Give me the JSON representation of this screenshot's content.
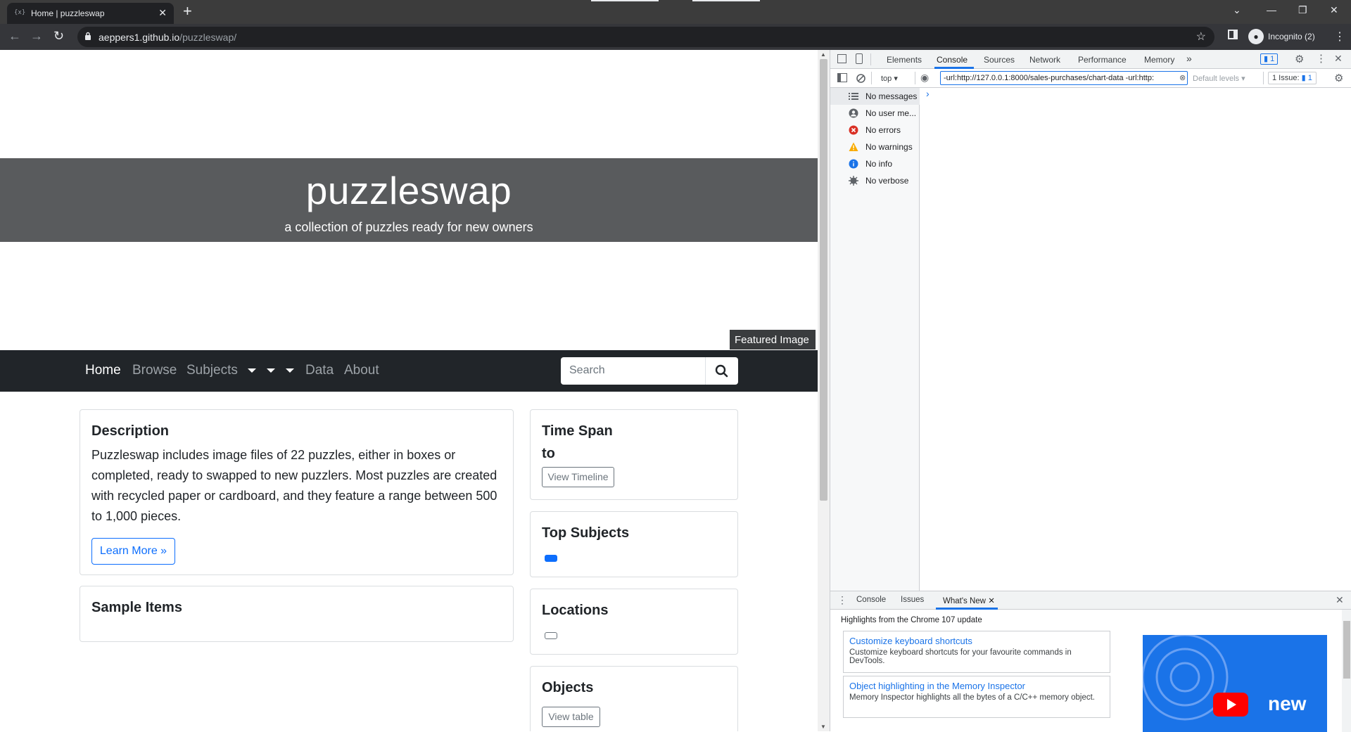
{
  "browser": {
    "tab_title": "Home | puzzleswap",
    "tab_favicon": "{x}",
    "url_host": "aeppers1.github.io",
    "url_path": "/puzzleswap/",
    "profile_label": "Incognito (2)"
  },
  "site": {
    "title": "puzzleswap",
    "subtitle": "a collection of puzzles ready for new owners",
    "featured_label": "Featured Image",
    "nav": {
      "home": "Home",
      "browse": "Browse",
      "subjects": "Subjects",
      "data": "Data",
      "about": "About"
    },
    "search_placeholder": "Search",
    "description": {
      "heading": "Description",
      "body": "Puzzleswap includes image files of 22 puzzles, either in boxes or completed, ready to swapped to new puzzlers. Most puzzles are created with recycled paper or cardboard, and they feature a range between 500 to 1,000 pieces.",
      "button": "Learn More »"
    },
    "sample_items": {
      "heading": "Sample Items"
    },
    "time_span": {
      "heading": "Time Span",
      "line2": "to",
      "button": "View Timeline"
    },
    "top_subjects": {
      "heading": "Top Subjects"
    },
    "locations": {
      "heading": "Locations"
    },
    "objects": {
      "heading": "Objects",
      "button": "View table"
    }
  },
  "devtools": {
    "tabs": [
      "Elements",
      "Console",
      "Sources",
      "Network",
      "Performance",
      "Memory"
    ],
    "active_tab": "Console",
    "issues_badge": "1",
    "context": "top",
    "filter_value": "-url:http://127.0.0.1:8000/sales-purchases/chart-data -url:http:",
    "levels": "Default levels",
    "issues_label": "1 Issue:",
    "issues_count": "1",
    "sidebar": [
      {
        "label": "No messages",
        "icon": "list-icon"
      },
      {
        "label": "No user me...",
        "icon": "user-icon"
      },
      {
        "label": "No errors",
        "icon": "error-icon"
      },
      {
        "label": "No warnings",
        "icon": "warning-icon"
      },
      {
        "label": "No info",
        "icon": "info-icon"
      },
      {
        "label": "No verbose",
        "icon": "verbose-icon"
      }
    ],
    "prompt": "›",
    "drawer": {
      "tabs": [
        "Console",
        "Issues",
        "What's New"
      ],
      "highlights": "Highlights from the Chrome 107 update",
      "cards": [
        {
          "title": "Customize keyboard shortcuts",
          "desc": "Customize keyboard shortcuts for your favourite commands in DevTools."
        },
        {
          "title": "Object highlighting in the Memory Inspector",
          "desc": "Memory Inspector highlights all the bytes of a C/C++ memory object."
        }
      ],
      "video_word": "new"
    }
  },
  "colors": {
    "hero": "#595b5d",
    "nav": "#212529",
    "primary": "#0d6efd",
    "devtools_accent": "#1a73e8"
  }
}
